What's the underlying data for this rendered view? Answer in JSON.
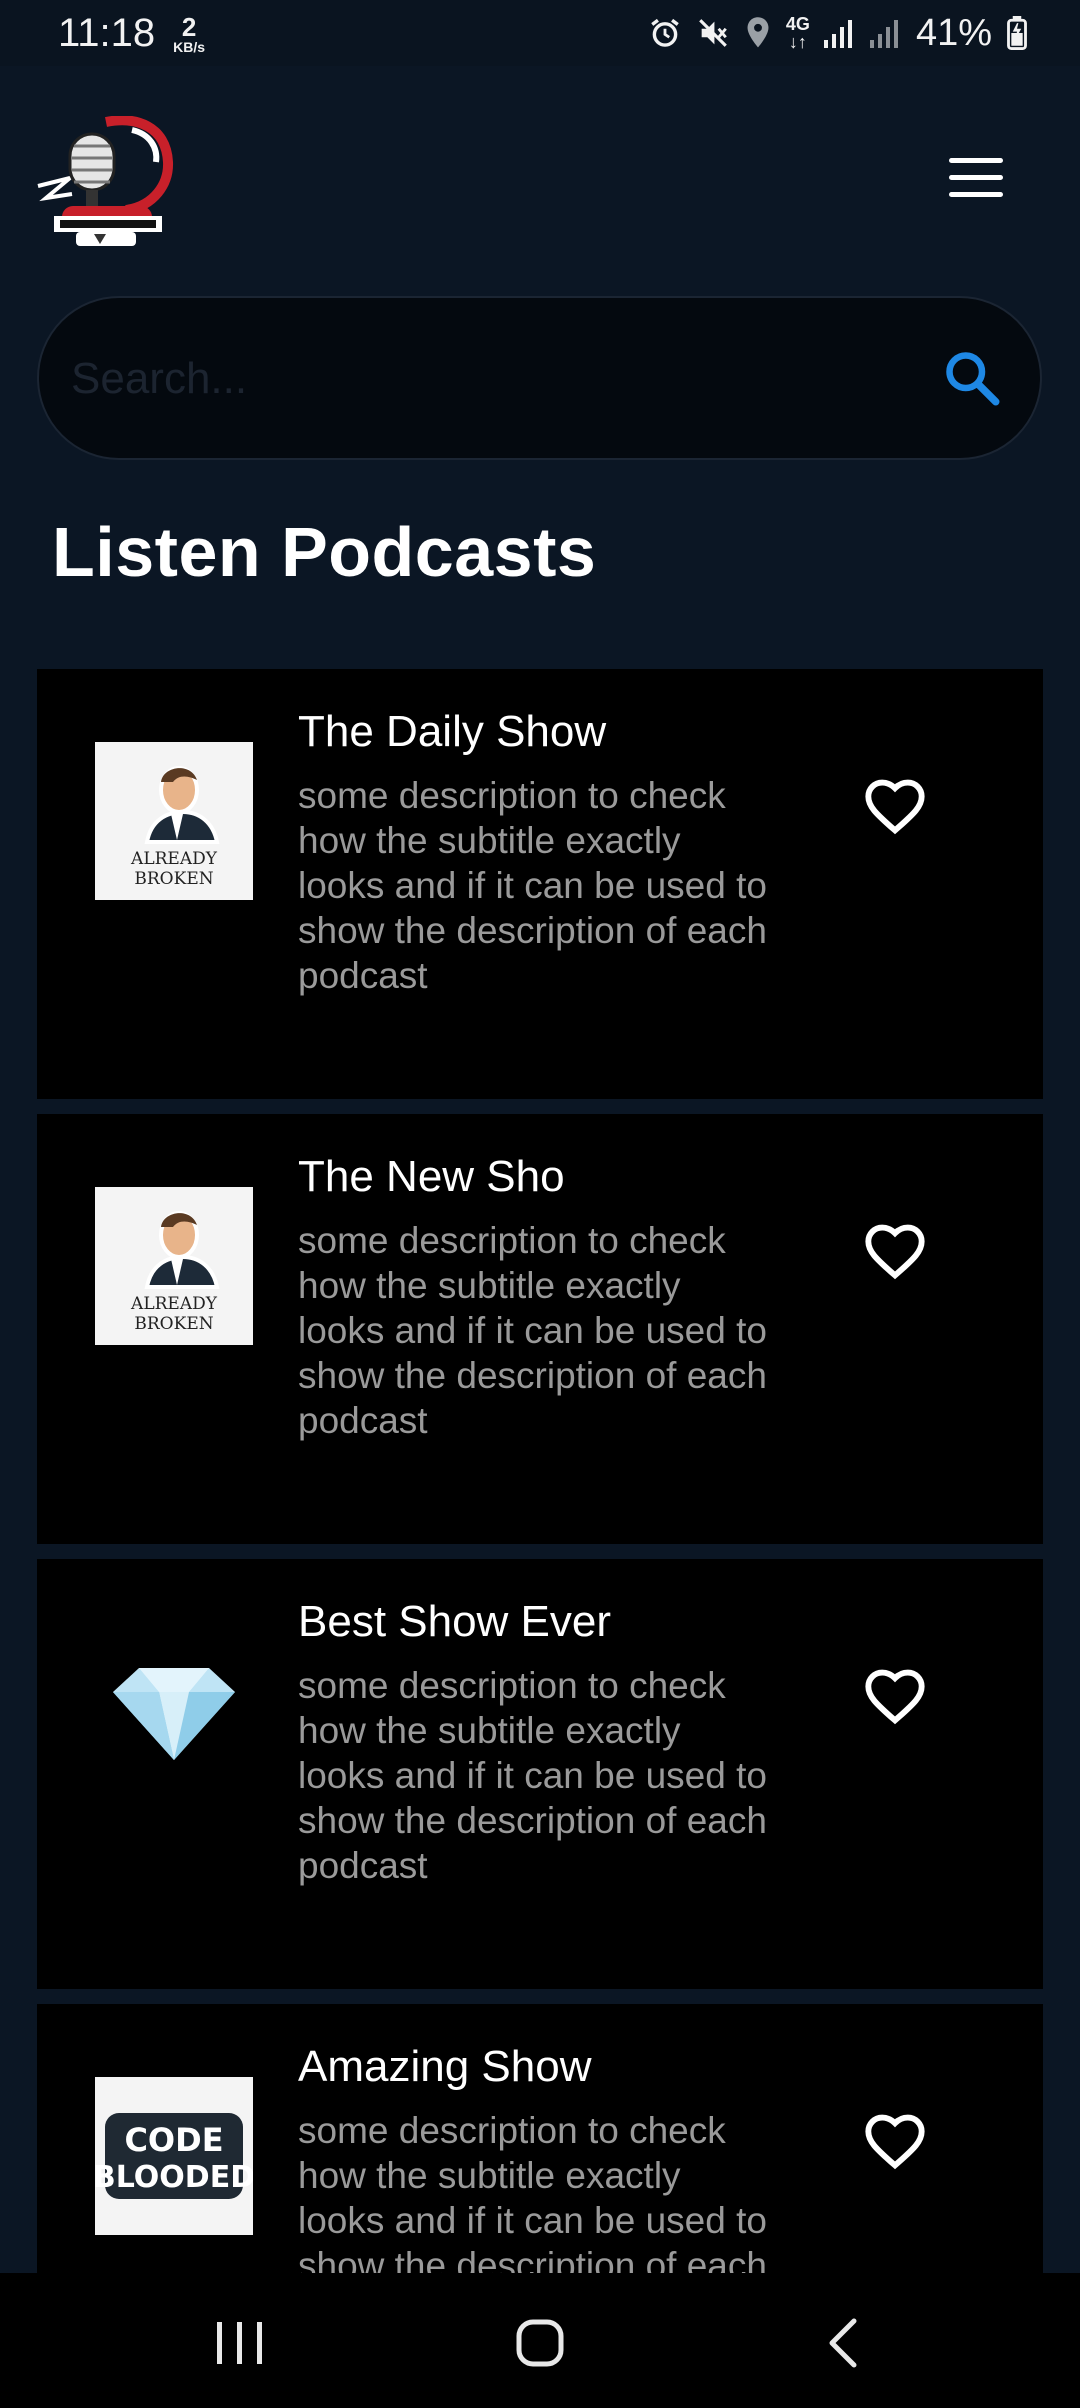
{
  "status_bar": {
    "time": "11:18",
    "data_rate": "2",
    "data_rate_unit": "KB/s",
    "network": "4G",
    "battery": "41%"
  },
  "search": {
    "placeholder": "Search...",
    "value": ""
  },
  "page": {
    "title": "Listen Podcasts"
  },
  "podcasts": [
    {
      "title": "The Daily Show",
      "description": "some description to check how the subtitle exactly looks and if it can be used to show the description of each podcast",
      "artwork": "already-broken-cover",
      "artwork_text": [
        "ALREADY",
        "BROKEN"
      ]
    },
    {
      "title": "The New Sho",
      "description": "some description to check how the subtitle exactly looks and if it can be used to show the description of each podcast",
      "artwork": "already-broken-cover",
      "artwork_text": [
        "ALREADY",
        "BROKEN"
      ]
    },
    {
      "title": "Best Show Ever",
      "description": "some description to check how the subtitle exactly looks and if it can be used to show the description of each podcast",
      "artwork": "diamond-cover"
    },
    {
      "title": "Amazing Show",
      "description": "some description to check how the subtitle exactly looks and if it can be used to show the description of each podcast",
      "artwork": "code-blooded-cover",
      "artwork_text": [
        "CODE",
        "BLOODED"
      ]
    }
  ],
  "colors": {
    "background": "#0b1624",
    "card": "#000000",
    "accent": "#1e88e5",
    "subtitle": "#9a9a9a"
  },
  "icons": {
    "menu": "hamburger-menu-icon",
    "search": "search-icon",
    "favorite": "heart-outline-icon",
    "nav": [
      "recent-apps-icon",
      "home-icon",
      "back-icon"
    ]
  }
}
